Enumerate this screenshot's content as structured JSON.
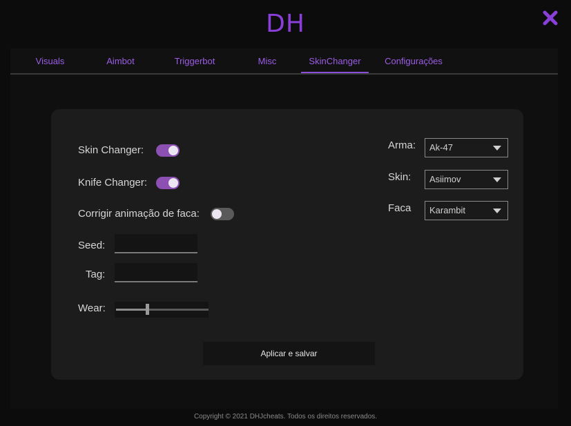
{
  "app": {
    "title": "DH"
  },
  "tabs": [
    {
      "label": "Visuals"
    },
    {
      "label": "Aimbot"
    },
    {
      "label": "Triggerbot"
    },
    {
      "label": "Misc"
    },
    {
      "label": "SkinChanger",
      "active": true
    },
    {
      "label": "Configurações"
    }
  ],
  "settings": {
    "skin_changer": {
      "label": "Skin Changer:",
      "on": true
    },
    "knife_changer": {
      "label": "Knife Changer:",
      "on": true
    },
    "knife_anim": {
      "label": "Corrigir animação de faca:",
      "on": false
    },
    "seed": {
      "label": "Seed:",
      "value": ""
    },
    "tag": {
      "label": "Tag:",
      "value": ""
    },
    "wear": {
      "label": "Wear:",
      "fraction": 0.32
    }
  },
  "selects": {
    "arma": {
      "label": "Arma:",
      "value": "Ak-47"
    },
    "skin": {
      "label": "Skin:",
      "value": "Asiimov"
    },
    "faca": {
      "label": "Faca",
      "value": "Karambit"
    }
  },
  "actions": {
    "apply_label": "Aplicar e salvar"
  },
  "footer": {
    "copyright": "Copyright © 2021 DHJcheats. Todos os direitos reservados."
  },
  "colors": {
    "accent": "#8b3fd9",
    "toggle_on": "#8c4fb2",
    "toggle_off": "#5a5a5a"
  }
}
